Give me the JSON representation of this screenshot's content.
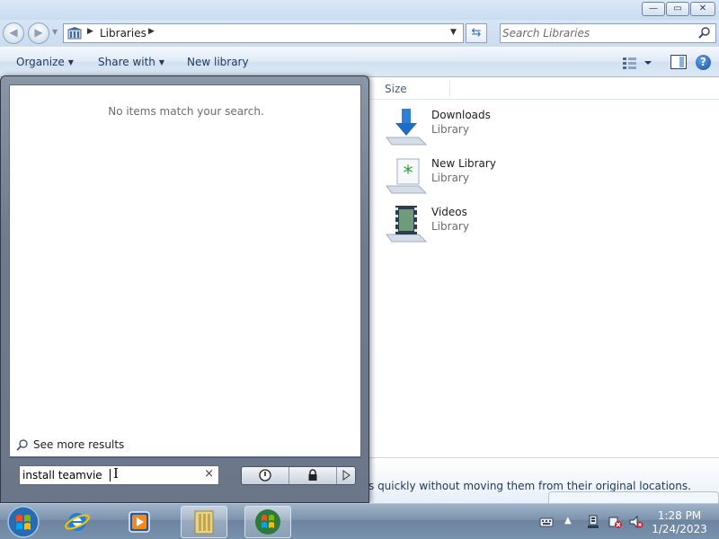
{
  "window": {
    "caption_buttons": {
      "minimize": "—",
      "maximize": "▭",
      "close": "✕"
    }
  },
  "address_bar": {
    "breadcrumb": [
      "Libraries"
    ],
    "search_placeholder": "Search Libraries"
  },
  "command_bar": {
    "organize": "Organize",
    "share_with": "Share with",
    "new_library": "New library"
  },
  "file_list": {
    "columns": [
      "Size"
    ],
    "items": [
      {
        "name": "Downloads",
        "type": "Library",
        "icon": "downloads-library-icon"
      },
      {
        "name": "New Library",
        "type": "Library",
        "icon": "new-library-icon"
      },
      {
        "name": "Videos",
        "type": "Library",
        "icon": "videos-library-icon"
      }
    ],
    "details_text": "s quickly without moving them from their original locations."
  },
  "start_menu": {
    "no_results": "No items match your search.",
    "see_more": "See more results",
    "search_value": "install teamvie",
    "clear_symbol": "×"
  },
  "taskbar": {
    "apps": [
      "internet-explorer",
      "windows-media-player",
      "windows-explorer",
      "windows-7-start"
    ],
    "tray_up_arrow": "▲",
    "clock_time": "1:28 PM",
    "clock_date": "1/24/2023"
  },
  "colors": {
    "accent": "#1e395b",
    "taskbar": "#7d93ad",
    "start_menu_frame": "#6f7b8c"
  }
}
